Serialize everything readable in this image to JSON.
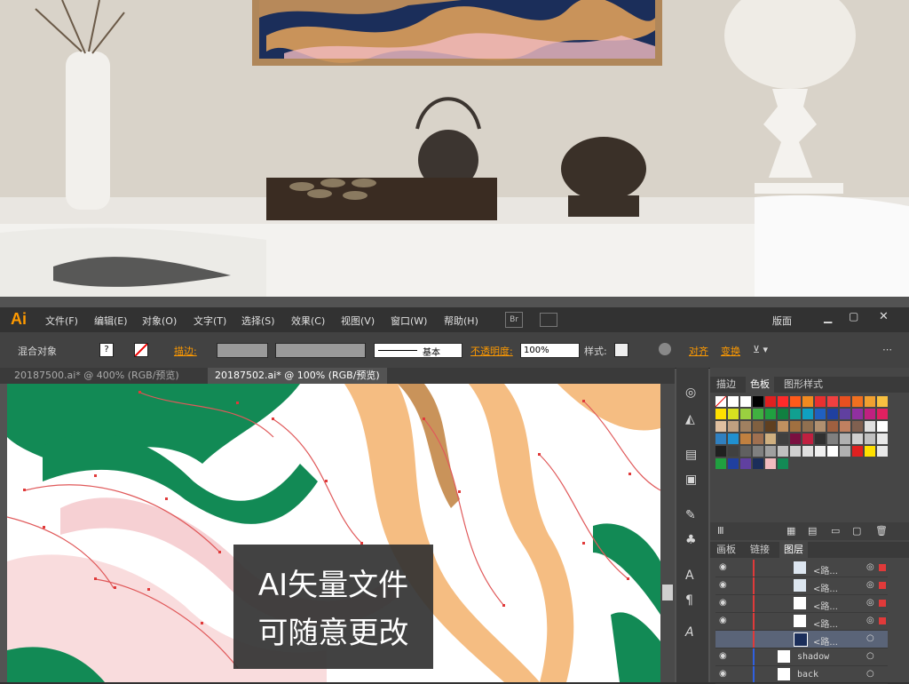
{
  "menubar": {
    "logo": "Ai",
    "items": [
      "文件(F)",
      "编辑(E)",
      "对象(O)",
      "文字(T)",
      "选择(S)",
      "效果(C)",
      "视图(V)",
      "窗口(W)",
      "帮助(H)"
    ],
    "br_label": "Br",
    "workspace": "版面"
  },
  "control_bar": {
    "selection_label": "混合对象",
    "stroke_label": "描边:",
    "brush_label": "基本",
    "opacity_label": "不透明度:",
    "opacity_value": "100%",
    "style_label": "样式:",
    "align_label": "对齐",
    "transform_label": "变换"
  },
  "doc_tabs": [
    {
      "label": "20187500.ai* @ 400% (RGB/预览)"
    },
    {
      "label": "20187502.ai* @ 100% (RGB/预览)"
    }
  ],
  "swatch_panel": {
    "tabs": [
      "描边",
      "色板",
      "图形样式"
    ]
  },
  "layers_panel": {
    "tabs": [
      "画板",
      "链接",
      "图层"
    ],
    "rows": [
      {
        "name": "<路..."
      },
      {
        "name": "<路..."
      },
      {
        "name": "<路..."
      },
      {
        "name": "<路..."
      },
      {
        "name": "<路..."
      },
      {
        "name": "shadow"
      },
      {
        "name": "back"
      }
    ]
  },
  "overlay": {
    "line1": "AI矢量文件",
    "line2": "可随意更改"
  },
  "colors": {
    "accent": "#ff9a00",
    "navy": "#1b2e5a",
    "gold": "#c9935a",
    "green": "#128a55",
    "pink": "#f2bcc0"
  }
}
